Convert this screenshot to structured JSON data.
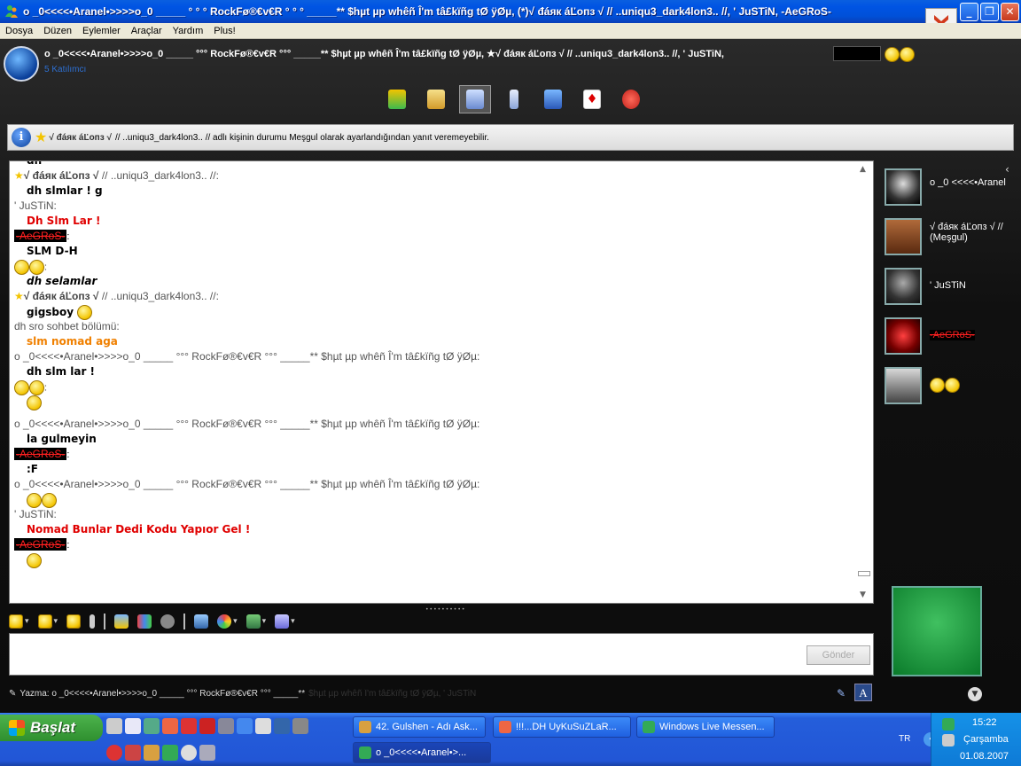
{
  "window": {
    "title": "o _0<<<<•Aranel•>>>>o_0 _____ ° ° ° RockFø®€v€R ° ° ° _____** $hµt µp whêñ Î'm tâ£kïñg tØ ÿØµ, (*)√ đáяк áĽoпз √  // ..uniqu3_dark4lon3.. //, ' JuSTiN, -AeGRoS-",
    "buttons": {
      "minimize": "_",
      "maximize": "❐",
      "close": "✕"
    }
  },
  "menu": [
    "Dosya",
    "Düzen",
    "Eylemler",
    "Araçlar",
    "Yardım",
    "Plus!"
  ],
  "conversation": {
    "title": "o _0<<<<•Aranel•>>>>o_0 _____ °°° RockFø®€v€R °°° _____** $hµt µp whêñ Î'm tâ£kïñg tØ ÿØµ, ★√ đáяк áĽoпз √  // ..uniqu3_dark4lon3.. //, ' JuSTiN,",
    "participant_count": "5 Katılımcı",
    "toolbar_icons": [
      "invite-contact-icon",
      "send-file-icon",
      "share-folders-icon",
      "phone-call-icon",
      "activities-icon",
      "games-icon",
      "block-icon"
    ]
  },
  "info_bar": {
    "icon": "info-icon",
    "name": "√ đáяк áĽoпз √",
    "message": "// ..uniqu3_dark4lon3.. // adlı kişinin durumu Meşgul olarak ayarlandığından yanıt veremeyebilir."
  },
  "chat": {
    "lines": [
      {
        "kind": "body",
        "text": "dh",
        "style": "cut"
      },
      {
        "kind": "sender-star",
        "name": "√ đáяк áĽoпз √",
        "rest": "  // ..uniqu3_dark4lon3.. //:"
      },
      {
        "kind": "body",
        "text": "dh slmlar ! g"
      },
      {
        "kind": "sender",
        "text": "' JuSTiN:"
      },
      {
        "kind": "body",
        "text": "Dh Slm Lar !",
        "style": "red"
      },
      {
        "kind": "aeg",
        "text": "-AeGRoS-"
      },
      {
        "kind": "body",
        "text": "SLM D-H"
      },
      {
        "kind": "smileys",
        "count": 2,
        "suffix": ":"
      },
      {
        "kind": "body",
        "text": "dh selamlar",
        "style": "italic"
      },
      {
        "kind": "sender-star",
        "name": "√ đáяк áĽoпз √",
        "rest": "  // ..uniqu3_dark4lon3.. //:"
      },
      {
        "kind": "body",
        "text": "gigsboy",
        "smiley": true
      },
      {
        "kind": "sender",
        "text": "dh sro sohbet bölümü:"
      },
      {
        "kind": "body",
        "text": "slm nomad aga",
        "style": "orange"
      },
      {
        "kind": "sender",
        "text": "o _0<<<<•Aranel•>>>>o_0 _____ °°° RockFø®€v€R °°° _____** $hµt µp whêñ Î'm tâ£kïñg tØ ÿØµ:"
      },
      {
        "kind": "body",
        "text": "dh slm lar !"
      },
      {
        "kind": "smileys",
        "count": 2,
        "suffix": ":"
      },
      {
        "kind": "body-smiley",
        "text": ""
      },
      {
        "kind": "spacer",
        "text": ""
      },
      {
        "kind": "sender",
        "text": "o _0<<<<•Aranel•>>>>o_0 _____ °°° RockFø®€v€R °°° _____** $hµt µp whêñ Î'm tâ£kïñg tØ ÿØµ:"
      },
      {
        "kind": "body",
        "text": "la gulmeyin"
      },
      {
        "kind": "aeg",
        "text": "-AeGRoS-"
      },
      {
        "kind": "body",
        "text": ":F"
      },
      {
        "kind": "sender",
        "text": "o _0<<<<•Aranel•>>>>o_0 _____ °°° RockFø®€v€R °°° _____** $hµt µp whêñ Î'm tâ£kïñg tØ ÿØµ:"
      },
      {
        "kind": "body-smileys",
        "count": 2
      },
      {
        "kind": "sender",
        "text": "' JuSTiN:"
      },
      {
        "kind": "body",
        "text": "Nomad Bunlar Dedi Kodu Yapıor Gel !",
        "style": "red"
      },
      {
        "kind": "aeg",
        "text": "-AeGRoS-"
      },
      {
        "kind": "body-smiley",
        "text": ""
      }
    ]
  },
  "participants": [
    {
      "name": "o _0 <<<<•Aranel",
      "style": "normal"
    },
    {
      "name": "√ đáяк áĽoпз √  // (Meşgul)",
      "style": "normal"
    },
    {
      "name": "' JuSTiN",
      "style": "normal"
    },
    {
      "name": "-AeGRoS-",
      "style": "red"
    },
    {
      "name": "",
      "style": "smileys"
    }
  ],
  "format_toolbar": [
    "emoticon-icon",
    "wink-icon",
    "voice-clip-icon",
    "nudge-icon",
    "ink-icon",
    "backgrounds-icon",
    "handwriting-icon",
    "display-pic-icon",
    "theme-icon",
    "games-icon",
    "gift-icon"
  ],
  "input": {
    "value": "",
    "send_label": "Gönder"
  },
  "status_line": {
    "prefix": "Yazma: o _0<<<<•Aranel•>>>>o_0 _____ °°° RockFø®€v€R °°° _____**",
    "rest": "$hµt µp whêñ Î'm tâ£kïñg tØ ÿØµ, ' JuSTiN"
  },
  "taskbar": {
    "start_label": "Başlat",
    "tasks": [
      {
        "label": "42. Gulshen - Adı Ask...",
        "active": false
      },
      {
        "label": "!!!...DH UyKuSuZLaR...",
        "active": false
      },
      {
        "label": "Windows Live Messen...",
        "active": false
      },
      {
        "label": "o _0<<<<•Aranel•>...",
        "active": true
      }
    ],
    "language": "TR",
    "clock": {
      "time": "15:22",
      "day": "Çarşamba",
      "date": "01.08.2007"
    }
  },
  "colors": {
    "accent_red": "#e00000",
    "accent_orange": "#f08000",
    "xp_blue": "#245edb"
  }
}
